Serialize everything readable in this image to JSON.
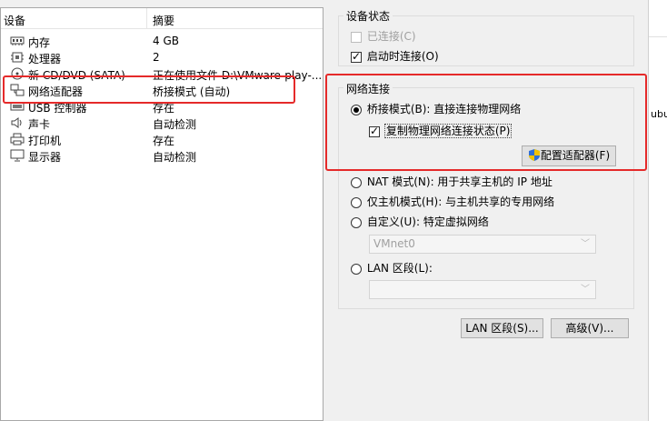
{
  "device_list": {
    "headers": {
      "device": "设备",
      "summary": "摘要"
    },
    "rows": [
      {
        "name": "内存",
        "summary": "4 GB",
        "icon": "memory-icon"
      },
      {
        "name": "处理器",
        "summary": "2",
        "icon": "processor-icon"
      },
      {
        "name": "新 CD/DVD (SATA)",
        "summary": "正在使用文件 D:\\VMware-play-...",
        "icon": "cd-dvd-icon"
      },
      {
        "name": "网络适配器",
        "summary": "桥接模式 (自动)",
        "icon": "network-adapter-icon"
      },
      {
        "name": "USB 控制器",
        "summary": "存在",
        "icon": "usb-icon"
      },
      {
        "name": "声卡",
        "summary": "自动检测",
        "icon": "speaker-icon"
      },
      {
        "name": "打印机",
        "summary": "存在",
        "icon": "printer-icon"
      },
      {
        "name": "显示器",
        "summary": "自动检测",
        "icon": "monitor-icon"
      }
    ]
  },
  "device_status": {
    "title": "设备状态",
    "connected": {
      "label": "已连接(C)",
      "checked": false,
      "disabled": true
    },
    "connect_at_power_on": {
      "label": "启动时连接(O)",
      "checked": true
    }
  },
  "network_connection": {
    "title": "网络连接",
    "bridged": {
      "label": "桥接模式(B): 直接连接物理网络",
      "selected": true
    },
    "replicate": {
      "label": "复制物理网络连接状态(P)",
      "checked": true
    },
    "configure_adapters": "配置适配器(F)",
    "nat": {
      "label": "NAT 模式(N): 用于共享主机的 IP 地址",
      "selected": false
    },
    "host_only": {
      "label": "仅主机模式(H): 与主机共享的专用网络",
      "selected": false
    },
    "custom": {
      "label": "自定义(U): 特定虚拟网络",
      "selected": false
    },
    "custom_network_value": "VMnet0",
    "lan_segment": {
      "label": "LAN 区段(L):",
      "selected": false
    },
    "lan_segment_value": ""
  },
  "buttons": {
    "lan_segments": "LAN 区段(S)...",
    "advanced": "高级(V)..."
  },
  "background_window": {
    "partial_text": "ubu"
  },
  "colors": {
    "highlight_red": "#e52a2a",
    "shield_blue": "#2f6fd6",
    "shield_yellow": "#f2c200"
  }
}
